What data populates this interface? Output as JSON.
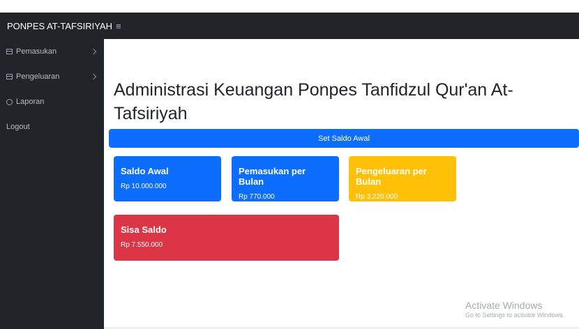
{
  "navbar": {
    "brand": "PONPES AT-TAFSIRIYAH",
    "toggle_icon": "≡"
  },
  "sidebar": {
    "items": [
      {
        "label": "Pemasukan",
        "icon": "table-icon",
        "has_submenu": true
      },
      {
        "label": "Pengeluaran",
        "icon": "table-icon",
        "has_submenu": true
      },
      {
        "label": "Laporan",
        "icon": "gauge-icon",
        "has_submenu": false
      },
      {
        "label": "Logout",
        "icon": "",
        "has_submenu": false
      }
    ]
  },
  "main": {
    "title": "Administrasi Keuangan Ponpes Tanfidzul Qur'an At-Tafsiriyah",
    "saldo_button": "Set Saldo Awal",
    "cards": [
      {
        "title": "Saldo Awal",
        "value": "Rp 10.000.000",
        "color": "#0d6efd"
      },
      {
        "title": "Pemasukan per Bulan",
        "value": "Rp 770.000",
        "color": "#0d6efd"
      },
      {
        "title": "Pengeluaran per Bulan",
        "value": "Rp 3.220.000",
        "color": "#ffc107"
      },
      {
        "title": "Sisa Saldo",
        "value": "Rp 7.550.000",
        "color": "#dc3545"
      }
    ]
  },
  "watermark": {
    "title": "Activate Windows",
    "subtitle": "Go to Settings to activate Windows."
  }
}
